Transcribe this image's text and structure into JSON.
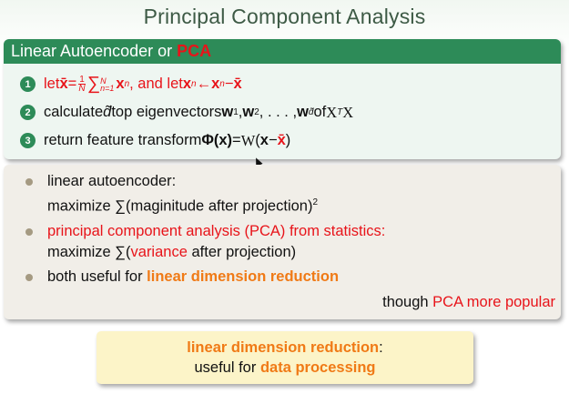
{
  "title": "Principal Component Analysis",
  "header": {
    "prefix": "Linear Autoencoder or ",
    "pca": "PCA"
  },
  "steps": {
    "n1": "1",
    "n2": "2",
    "n3": "3",
    "s1_let": "let ",
    "s1_xbar": "x̄",
    "s1_eq": " = ",
    "s1_frac_num": "1",
    "s1_frac_den": "N",
    "s1_sum": "∑",
    "s1_sum_top": "N",
    "s1_sum_bot": "n=1",
    "s1_xn": " x",
    "s1_n": "n",
    "s1_mid": ", and let ",
    "s1_xn2": "x",
    "s1_arrow": " ← ",
    "s1_xn3": "x",
    "s1_minus": " − ",
    "s1_xbar2": "x̄",
    "s2_text": "calculate ",
    "s2_d": "d̃",
    "s2_mid": " top eigenvectors ",
    "s2_w1": "w",
    "s2_sub1": "1",
    "s2_comma": ", ",
    "s2_w2": "w",
    "s2_sub2": "2",
    "s2_dots": ", . . . , ",
    "s2_wd": "w",
    "s2_subd": "d̃",
    "s2_of": " of ",
    "s2_X": "X",
    "s2_T": "T",
    "s2_X2": "X",
    "s3_text": "return feature transform ",
    "s3_phi": "Φ",
    "s3_arg": "(x)",
    "s3_eq": " = ",
    "s3_W": "W",
    "s3_open": "(",
    "s3_x": "x",
    "s3_minus": "−",
    "s3_xbar": "x̄",
    "s3_close": ")"
  },
  "bullets": {
    "b1_line1": "linear autoencoder:",
    "b1_line2": "maximize ∑(maginitude after projection)",
    "b1_sup": "2",
    "b2_red": "principal component analysis (PCA) from statistics:",
    "b2_pre": "maximize ∑(",
    "b2_var": "variance",
    "b2_post": " after projection)",
    "b3_pre": "both useful for ",
    "b3_orange": "linear dimension reduction",
    "popular_pre": "though ",
    "popular_red": "PCA more popular"
  },
  "footer": {
    "line1_orange": "linear dimension reduction",
    "line1_post": ":",
    "line2_pre": "useful for ",
    "line2_orange": "data processing"
  },
  "colors": {
    "green": "#2d8b58",
    "red": "#e8141a",
    "orange": "#f07a16"
  }
}
